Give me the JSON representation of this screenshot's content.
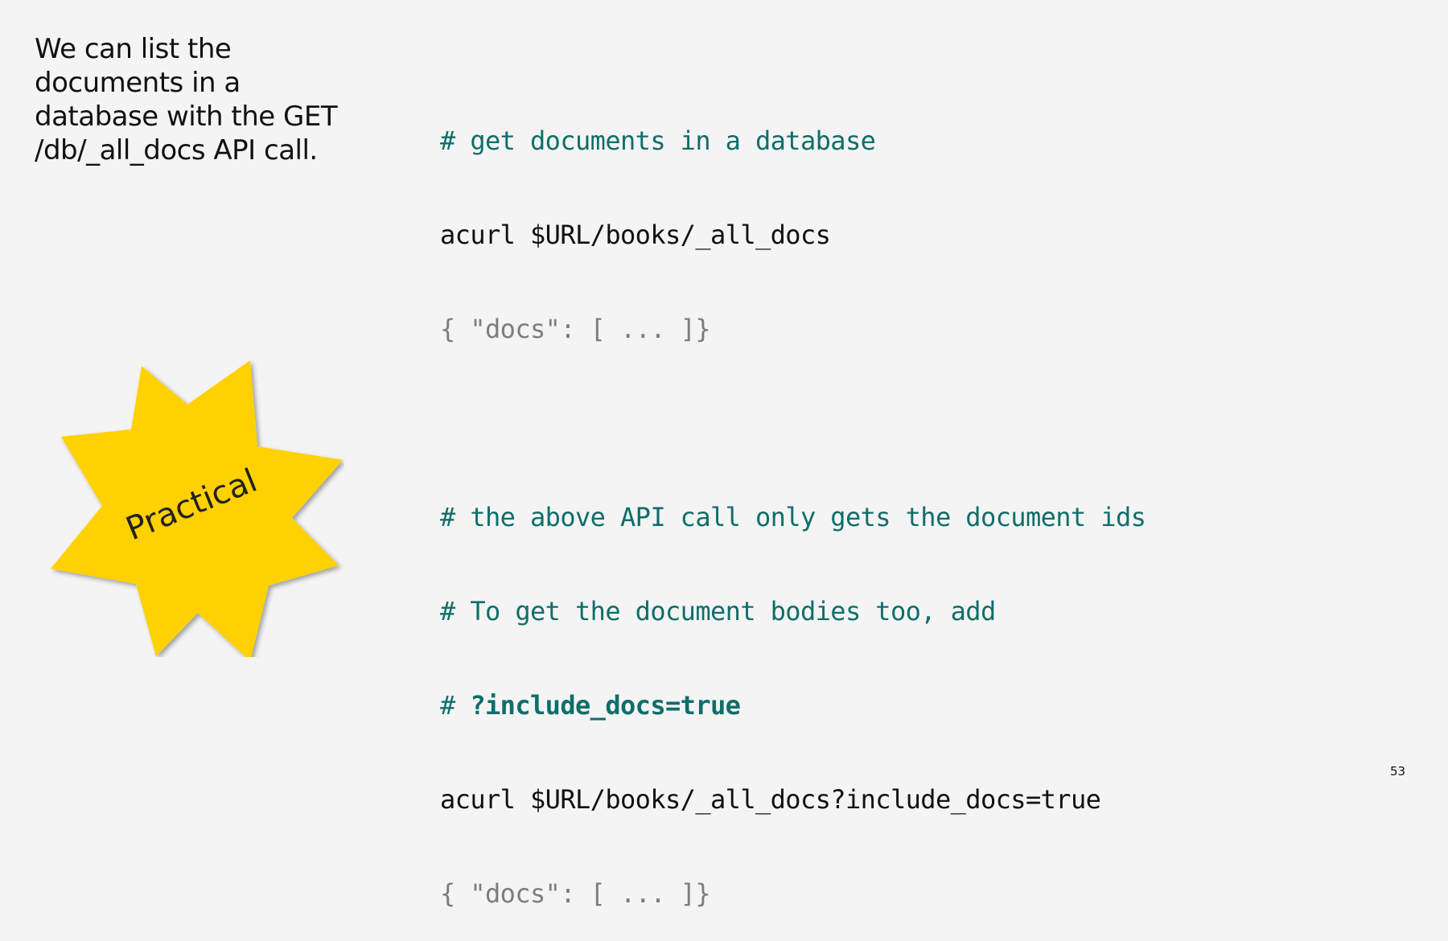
{
  "intro": {
    "lines": [
      "We can list the",
      "documents in a",
      "database with the GET",
      "/db/_all_docs API call."
    ]
  },
  "code": {
    "block1_comment": "# get documents in a database",
    "block1_cmd": "acurl $URL/books/_all_docs",
    "block1_output": "{ \"docs\": [ ... ]}",
    "block2_comment1": "# the above API call only gets the document ids",
    "block2_comment2": "# To get the document bodies too, add",
    "block2_comment3_prefix": "# ",
    "block2_comment3_bold": "?include_docs=true",
    "block2_cmd": "acurl $URL/books/_all_docs?include_docs=true",
    "block2_output": "{ \"docs\": [ ... ]}"
  },
  "badge": {
    "label": "Practical",
    "color": "#ffd100"
  },
  "page_number": "53"
}
